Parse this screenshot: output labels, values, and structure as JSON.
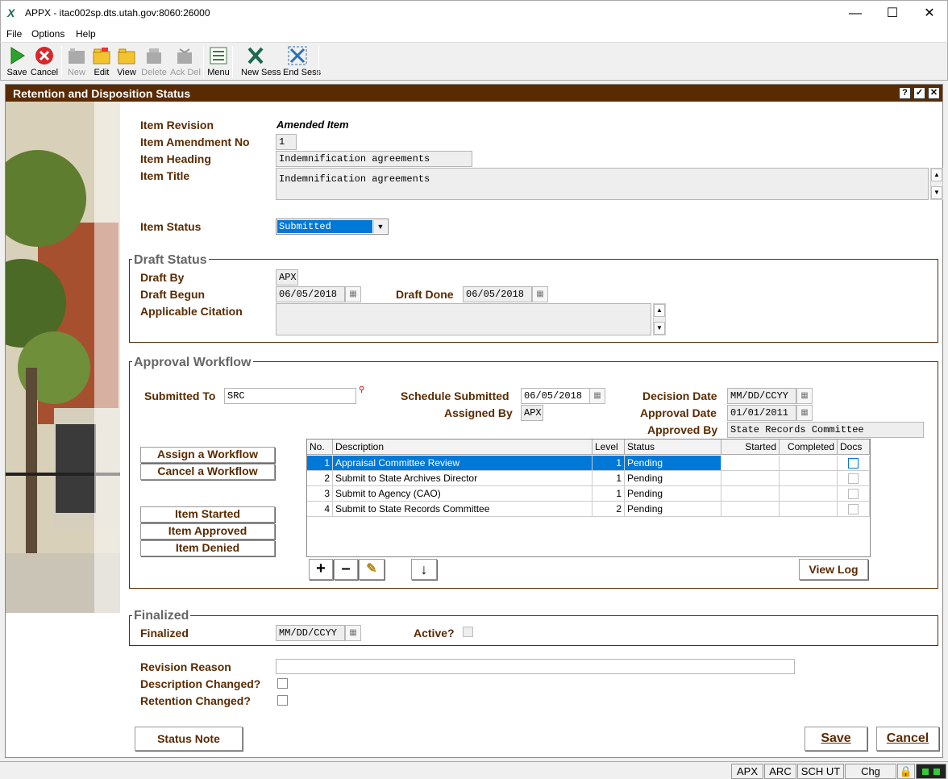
{
  "window": {
    "title": "APPX - itac002sp.dts.utah.gov:8060:26000"
  },
  "menu": [
    "File",
    "Options",
    "Help"
  ],
  "toolbar": {
    "save": "Save",
    "cancel": "Cancel",
    "new": "New",
    "edit": "Edit",
    "view": "View",
    "delete": "Delete",
    "ackdel": "Ack Del",
    "menu": "Menu",
    "newsess": "New Sess",
    "endsess": "End Sess"
  },
  "form": {
    "title": "Retention and Disposition Status",
    "item_revision_label": "Item Revision",
    "item_revision_value": "Amended Item",
    "amendment_label": "Item Amendment No",
    "amendment_value": "1",
    "heading_label": "Item Heading",
    "heading_value": "Indemnification agreements",
    "title_label": "Item Title",
    "title_value": "Indemnification agreements",
    "status_label": "Item Status",
    "status_value": "Submitted"
  },
  "draft": {
    "group": "Draft Status",
    "by_label": "Draft By",
    "by_value": "APX",
    "begun_label": "Draft Begun",
    "begun_value": "06/05/2018",
    "done_label": "Draft Done",
    "done_value": "06/05/2018",
    "citation_label": "Applicable Citation",
    "citation_value": ""
  },
  "approval": {
    "group": "Approval Workflow",
    "submitted_to_label": "Submitted To",
    "submitted_to_value": "SRC",
    "schedule_label": "Schedule Submitted",
    "schedule_value": "06/05/2018",
    "assigned_label": "Assigned By",
    "assigned_value": "APX",
    "decision_label": "Decision Date",
    "decision_value": "MM/DD/CCYY",
    "approval_label": "Approval Date",
    "approval_value": "01/01/2011",
    "approved_by_label": "Approved By",
    "approved_by_value": "State Records Committee",
    "assign_btn": "Assign a Workflow",
    "cancel_btn": "Cancel a Workflow",
    "started_btn": "Item Started",
    "approved_btn": "Item Approved",
    "denied_btn": "Item Denied",
    "view_log": "View Log"
  },
  "grid": {
    "columns": [
      "No.",
      "Description",
      "Level",
      "Status",
      "Started",
      "Completed",
      "Docs"
    ],
    "rows": [
      {
        "no": "1",
        "desc": "Appraisal Committee Review",
        "level": "1",
        "status": "Pending",
        "selected": true
      },
      {
        "no": "2",
        "desc": "Submit to State Archives Director",
        "level": "1",
        "status": "Pending"
      },
      {
        "no": "3",
        "desc": "Submit to Agency (CAO)",
        "level": "1",
        "status": "Pending"
      },
      {
        "no": "4",
        "desc": "Submit to State Records Committee",
        "level": "2",
        "status": "Pending"
      }
    ]
  },
  "finalized": {
    "group": "Finalized",
    "label": "Finalized",
    "value": "MM/DD/CCYY",
    "active_label": "Active?"
  },
  "revision": {
    "reason_label": "Revision Reason",
    "desc_changed_label": "Description Changed?",
    "ret_changed_label": "Retention Changed?"
  },
  "buttons": {
    "status_note": "Status Note",
    "save": "Save",
    "cancel": "Cancel"
  },
  "statusbar": [
    "APX",
    "ARC",
    "SCH UT",
    "Chg"
  ]
}
